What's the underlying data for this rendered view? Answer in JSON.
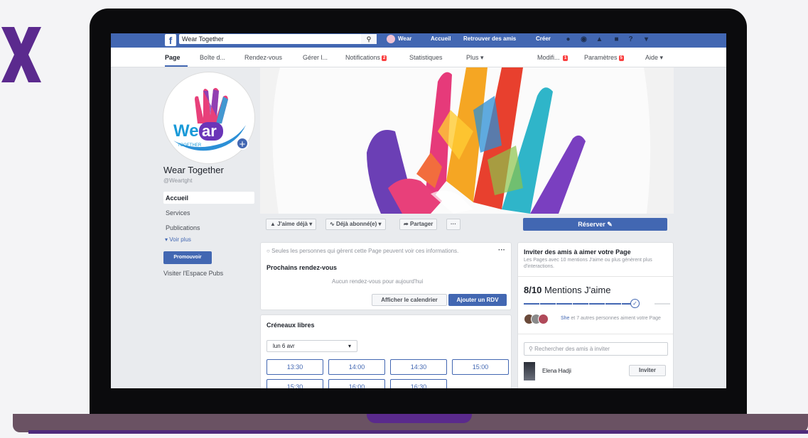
{
  "topbar": {
    "logo": "f",
    "search_value": "Wear Together",
    "search_icon": "search-icon",
    "profile_name": "Wear",
    "links": [
      "Accueil",
      "Retrouver des amis",
      "Créer"
    ],
    "icons": [
      "friends-icon",
      "messenger-icon",
      "notifications-icon",
      "page-switch-icon",
      "help-icon",
      "caret-down-icon"
    ]
  },
  "tabs": {
    "items": [
      "Page",
      "Boîte d...",
      "Rendez-vous",
      "Gérer l...",
      "Notifications",
      "Statistiques",
      "Plus ▾"
    ],
    "notifications_badge": "2",
    "right_items": [
      "Modifi...",
      "Paramètres",
      "Aide ▾"
    ],
    "modif_badge": "1",
    "settings_badge": "5"
  },
  "profile": {
    "logo_text_1": "We",
    "logo_text_2": "ar",
    "logo_text_3": "TOGETHER",
    "name": "Wear Together",
    "handle": "@Weartght"
  },
  "left_nav": {
    "items": [
      "Accueil",
      "Services",
      "Publications"
    ],
    "more": "Voir plus",
    "promote": "Promouvoir",
    "ads": "Visiter l'Espace Pubs"
  },
  "actions": {
    "like": "J'aime déjà ▾",
    "follow": "Déjà abonné(e) ▾",
    "share": "Partager",
    "more": "···",
    "reserve": "Réserver ✎"
  },
  "appointments": {
    "notice": "Seules les personnes qui gèrent cette Page peuvent voir ces informations.",
    "more": "···",
    "title": "Prochains rendez-vous",
    "empty": "Aucun rendez-vous pour aujourd'hui",
    "calendar_button": "Afficher le calendrier",
    "add_button": "Ajouter un RDV"
  },
  "slots": {
    "title": "Créneaux libres",
    "day": "lun 6 avr",
    "times": [
      "13:30",
      "14:00",
      "14:30",
      "15:00",
      "15:30",
      "16:00",
      "16:30"
    ]
  },
  "invite": {
    "title": "Inviter des amis à aimer votre Page",
    "subtitle": "Les Pages avec 10 mentions J'aime ou plus génèrent plus d'interactions.",
    "likes_count": "8/10",
    "likes_label": "Mentions J'aime",
    "likes_progress": 0.8,
    "friends_text_1": "She",
    "friends_text_2": " et 7 autres personnes aiment votre Page",
    "search_placeholder": "Rechercher des amis à inviter",
    "friend_name": "Elena Hadji",
    "invite_button": "Inviter"
  },
  "colors": {
    "facebook_blue": "#4267b2",
    "brand_purple": "#5a2a8c",
    "badge_red": "#fa3e3e"
  }
}
